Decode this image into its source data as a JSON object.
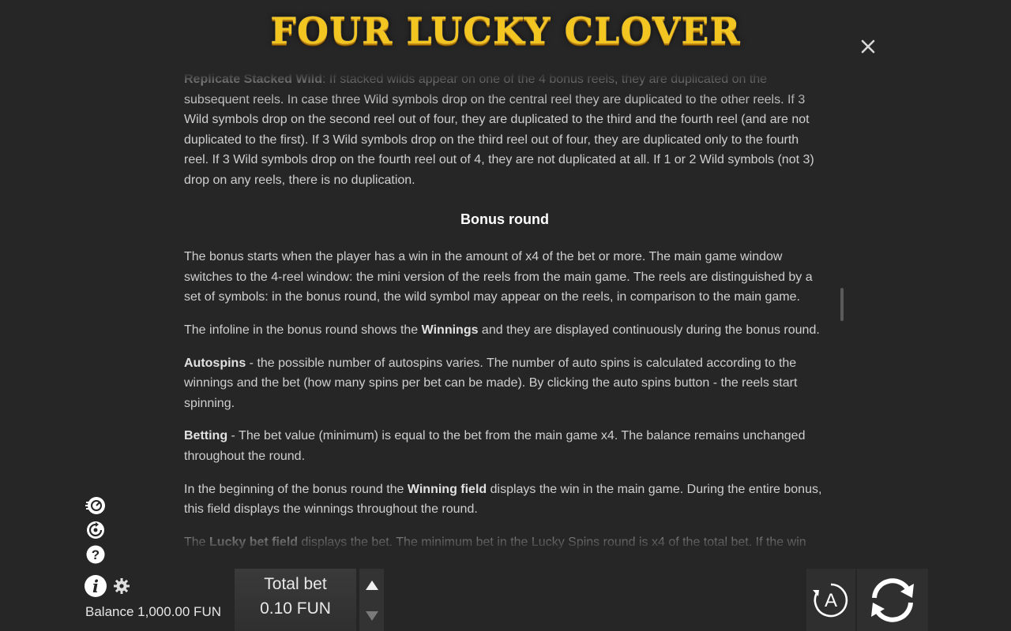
{
  "header": {
    "logo_text": "FOUR LUCKY CLOVER",
    "close_glyph": "×"
  },
  "rules": {
    "top_partial_bold": "Replicate Stacked Wild",
    "top_partial_text": ": If stacked wilds appear on one of the 4 bonus reels, they are duplicated on the subsequent reels. In case three Wild symbols drop on the central reel they are duplicated to the other reels. If 3 Wild symbols drop on the second reel out of four, they are duplicated to the third and the fourth reel (and are not duplicated to the first). If 3 Wild symbols drop on the third reel out of four, they are duplicated only to the fourth reel. If 3 Wild symbols drop on the fourth reel out of 4, they are not duplicated at all. If 1 or 2 Wild symbols (not 3) drop on any reels, there is no duplication.",
    "heading": "Bonus round",
    "p1": "The bonus starts when the player has a win in the amount of x4 of the bet or more. The main game window switches to the 4-reel window: the mini version of the reels from the main game. The reels are distinguished by a set of symbols: in the bonus round, the wild symbol may appear on the reels, in comparison to the main game.",
    "p2_a": "The infoline in the bonus round shows the ",
    "p2_b": "Winnings",
    "p2_c": " and they are displayed continuously during the bonus round.",
    "p3_b": "Autospins",
    "p3_c": " - the possible number of autospins varies. The number of auto spins is calculated according to the winnings and the bet (how many spins per bet can be made). By clicking the auto spins button - the reels start spinning.",
    "p4_b": "Betting",
    "p4_c": " - The bet value (minimum) is equal to the bet from the main game x4. The balance remains unchanged throughout the round.",
    "p5_a": "In the beginning of the bonus round the ",
    "p5_b": "Winning field",
    "p5_c": " displays the win in the main game. During the entire bonus, this field displays the winnings throughout the round.",
    "p6_a": "The ",
    "p6_b": "Lucky bet field",
    "p6_c": " displays the bet. The minimum bet in the Lucky Spins round is x4 of the total bet. If the win"
  },
  "footer": {
    "balance": "Balance 1,000.00 FUN",
    "total_bet_label": "Total bet",
    "total_bet_value": "0.10 FUN",
    "auto_letter": "A"
  },
  "icons": [
    "speed-icon",
    "autoplay-icon",
    "help-icon",
    "info-icon",
    "gear-icon",
    "close-icon",
    "arrow-up-icon",
    "arrow-down-icon",
    "autospin-icon",
    "spin-icon"
  ],
  "colors": {
    "background": "#262626",
    "logo_gold": "#f3c521",
    "text": "#cfcfcf"
  }
}
